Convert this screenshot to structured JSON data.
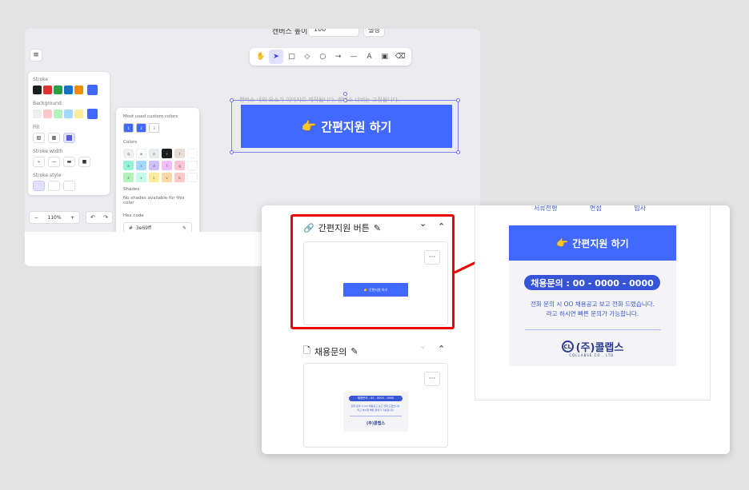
{
  "editor": {
    "topbar": {
      "label": "캔버스 높이",
      "value": "100",
      "button": "설정"
    },
    "menu_icon": "≡",
    "tools": [
      {
        "name": "hand-tool",
        "glyph": "✋",
        "active": false
      },
      {
        "name": "select-tool",
        "glyph": "➤",
        "active": true
      },
      {
        "name": "rectangle-tool",
        "glyph": "□",
        "active": false
      },
      {
        "name": "diamond-tool",
        "glyph": "◇",
        "active": false
      },
      {
        "name": "ellipse-tool",
        "glyph": "○",
        "active": false
      },
      {
        "name": "arrow-tool",
        "glyph": "→",
        "active": false
      },
      {
        "name": "line-tool",
        "glyph": "—",
        "active": false
      },
      {
        "name": "text-tool",
        "glyph": "A",
        "active": false
      },
      {
        "name": "image-tool",
        "glyph": "▣",
        "active": false
      },
      {
        "name": "eraser-tool",
        "glyph": "⌫",
        "active": false
      }
    ],
    "props": {
      "stroke_label": "Stroke",
      "stroke_colors": [
        "#1e1e1e",
        "#e03131",
        "#2f9e44",
        "#1971c2",
        "#f08c00"
      ],
      "stroke_current": "#4169ff",
      "background_label": "Background",
      "background_colors": [
        "#eeeeee",
        "#ffc9c9",
        "#b2f2bb",
        "#a5d8ff",
        "#ffec99"
      ],
      "background_current": "#4169ff",
      "fill_label": "Fill",
      "stroke_width_label": "Stroke width",
      "stroke_style_label": "Stroke style"
    },
    "colorpop": {
      "most_used_label": "Most used custom colors",
      "most_used": [
        {
          "key": "1",
          "color": "#3e69ff"
        },
        {
          "key": "2",
          "color": "#3e69ff"
        },
        {
          "key": "3",
          "color": "#ffffff"
        }
      ],
      "colors_label": "Colors",
      "colors": [
        {
          "key": "q",
          "color": "#f0f0f0"
        },
        {
          "key": "w",
          "color": "#ffffff"
        },
        {
          "key": "e",
          "color": "#e9ecef"
        },
        {
          "key": "r",
          "color": "#1e1e1e"
        },
        {
          "key": "t",
          "color": "#eaddd7"
        },
        {
          "key": "",
          "color": "#ffffff"
        },
        {
          "key": "a",
          "color": "#96f2d7"
        },
        {
          "key": "s",
          "color": "#a5d8ff"
        },
        {
          "key": "d",
          "color": "#d0bfff"
        },
        {
          "key": "f",
          "color": "#eebefa"
        },
        {
          "key": "g",
          "color": "#fcc2d7"
        },
        {
          "key": "",
          "color": "#ffffff"
        },
        {
          "key": "z",
          "color": "#b2f2bb"
        },
        {
          "key": "x",
          "color": "#c3fae8"
        },
        {
          "key": "c",
          "color": "#ffec99"
        },
        {
          "key": "v",
          "color": "#ffd8a8"
        },
        {
          "key": "b",
          "color": "#ffc9c9"
        },
        {
          "key": "",
          "color": "#ffffff"
        }
      ],
      "shades_label": "Shades",
      "shades_note": "No shades available for this color",
      "hex_label": "Hex code",
      "hex_prefix": "#",
      "hex_value": "3e69ff"
    },
    "zoom": {
      "minus": "−",
      "value": "110%",
      "plus": "+"
    },
    "undo": "↶",
    "redo": "↷",
    "canvas_hint": "캔버스 내의 요소가 이미지로 제작됩니다. 캔버스 너비는 고정됩니다.",
    "canvas_button": {
      "emoji": "👉",
      "label": "간편지원 하기"
    }
  },
  "panel": {
    "sections": [
      {
        "icon": "link-icon",
        "glyph": "🔗",
        "title": "간편지원 버튼",
        "expanded": true
      },
      {
        "icon": "document-icon",
        "glyph": "🗋",
        "title": "채용문의",
        "expanded": false
      }
    ],
    "more_label": "···",
    "chevron_down": "⌄",
    "chevron_up": "⌃",
    "edit_glyph": "✎",
    "thumb1": {
      "label": "👉 간편지원 하기"
    },
    "thumb2": {
      "pill": "채용문의 : 00 - 0000 - 0000",
      "line1": "전화 문의 시 OO 채용공고 보고 전화 드렸습니다.",
      "line2": "라고 하시면 빠른 문의가 가능합니다.",
      "logo": "(주)콜랩스"
    },
    "preview": {
      "nav": [
        "서류전형",
        "면접",
        "입사"
      ],
      "button_emoji": "👉",
      "button_label": "간편지원 하기",
      "pill": "채용문의 : 00 - 0000 - 0000",
      "line1": "전화 문의 시 OO 채용공고 보고 전화 드렸습니다.",
      "line2": "라고 하시면 빠른 문의가 가능합니다.",
      "logo_mark": "CL",
      "logo_text": "(주)콜랩스",
      "logo_sub": "COLLABSE CO., LTD."
    }
  },
  "annotation": {
    "color": "#ee0000"
  }
}
